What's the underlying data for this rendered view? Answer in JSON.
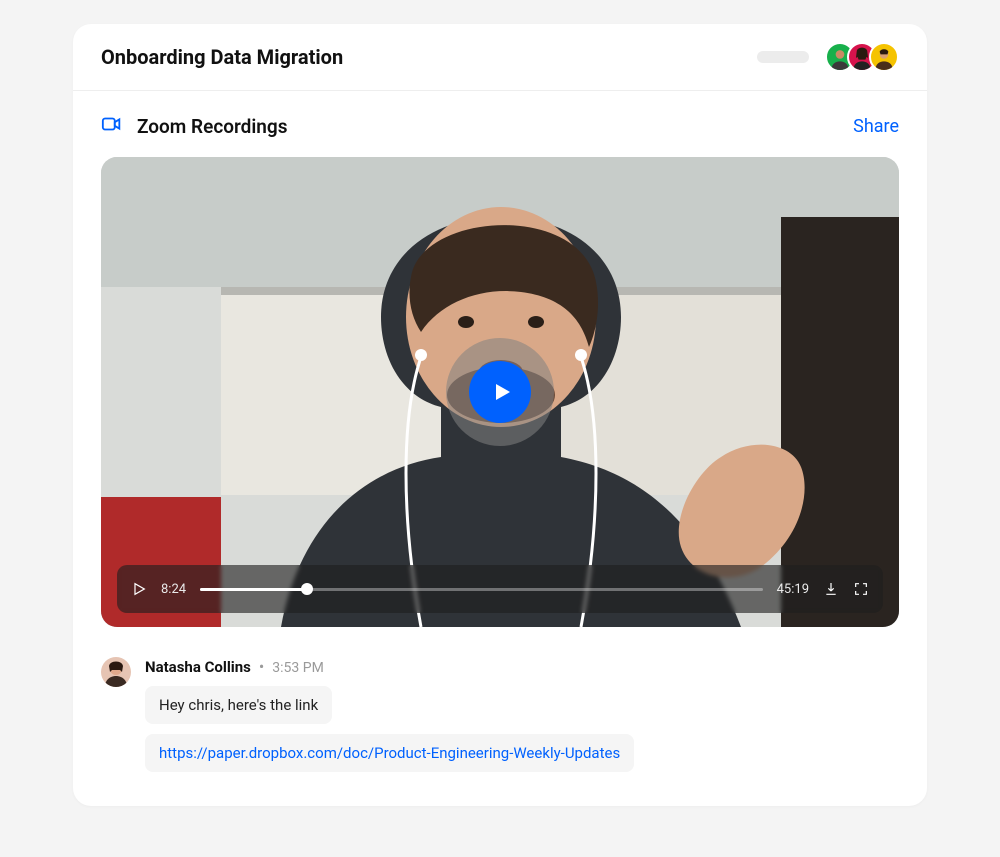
{
  "header": {
    "title": "Onboarding Data Migration",
    "avatars": [
      {
        "bg": "#17b04b"
      },
      {
        "bg": "#d6134c"
      },
      {
        "bg": "#f5c300"
      }
    ]
  },
  "section": {
    "title": "Zoom Recordings",
    "share_label": "Share"
  },
  "video": {
    "current_time": "8:24",
    "duration": "45:19",
    "progress_percent": 19
  },
  "comment": {
    "author": "Natasha Collins",
    "time": "3:53 PM",
    "text": "Hey chris, here's the link",
    "link": "https://paper.dropbox.com/doc/Product-Engineering-Weekly-Updates"
  }
}
